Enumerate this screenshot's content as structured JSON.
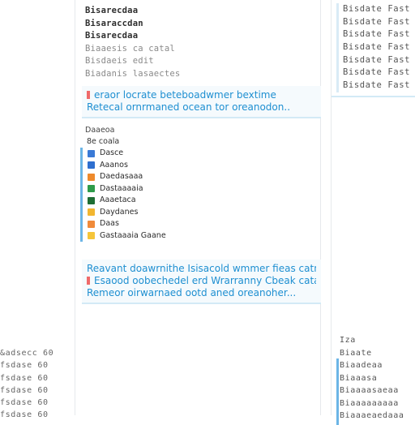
{
  "main": {
    "top_rows": [
      {
        "label": "Bisarecdaa",
        "muted": false
      },
      {
        "label": "Bisaraccdan",
        "muted": false
      },
      {
        "label": "Bisarecdaa",
        "muted": false
      },
      {
        "label": "Biaaesis ca catal",
        "muted": true
      },
      {
        "label": "Bisdaeis edit",
        "muted": true
      },
      {
        "label": "Biadanis lasaectes",
        "muted": true
      }
    ],
    "banner_1": {
      "line_1": "eraor locrate beteboadwmer bextime",
      "line_2": "Retecal ornrmaned ocean tor oreanodon.."
    },
    "section_title": "Daaeoa",
    "tree_caption": "8e coala",
    "tree_items": [
      {
        "label": "Dasce",
        "icon_name": "app-icon-blue",
        "color": "#3a7ad6"
      },
      {
        "label": "Aaanos",
        "icon_name": "app-icon-blue2",
        "color": "#2e6fcf"
      },
      {
        "label": "Daedasaaa",
        "icon_name": "app-icon-orange",
        "color": "#ee8a2c"
      },
      {
        "label": "Dastaaaaia",
        "icon_name": "app-icon-green",
        "color": "#2e9c4a"
      },
      {
        "label": "Aaaetaca",
        "icon_name": "app-icon-darkgreen",
        "color": "#1f6e34"
      },
      {
        "label": "Daydanes",
        "icon_name": "app-icon-yellow",
        "color": "#f2b630"
      },
      {
        "label": "Daas",
        "icon_name": "app-icon-orange2",
        "color": "#f08a3a"
      },
      {
        "label": "Gastaaaia Gaane",
        "icon_name": "app-icon-yellow2",
        "color": "#f5c53a"
      }
    ],
    "banner_2": {
      "line_1": "Reavant doawrnithe Isisacold wmmer fieas catna",
      "line_2": "Esaood oobechedel erd Wrarranny Cbeak cata",
      "line_3": "Remeor oirwarnaed ootd aned oreanoher..."
    }
  },
  "right": {
    "rows": [
      "Bisdate Fast",
      "Bisdate Fast",
      "Bisdate Fast",
      "Bisdate Fast",
      "Bisdate Fast",
      "Bisdate Fast",
      "Bisdate Fast"
    ],
    "bottom_rows": [
      "Iza",
      "Biaate",
      "Biaadeaa",
      "Biaaasa",
      "Biaaaasaeaa",
      "Biaaaaaaaaa",
      "Biaaaeaedaaa"
    ]
  },
  "left_edge": {
    "rows": [
      "&adsecc 60",
      "fsdase 60",
      "fsdase 60",
      "fsdase 60",
      "fsdase 60",
      "fsdase 60"
    ]
  },
  "colors": {
    "accent": "#1e8fd1",
    "selection_bar": "#6cb5e6",
    "indicator_red": "#ef6a6a"
  }
}
